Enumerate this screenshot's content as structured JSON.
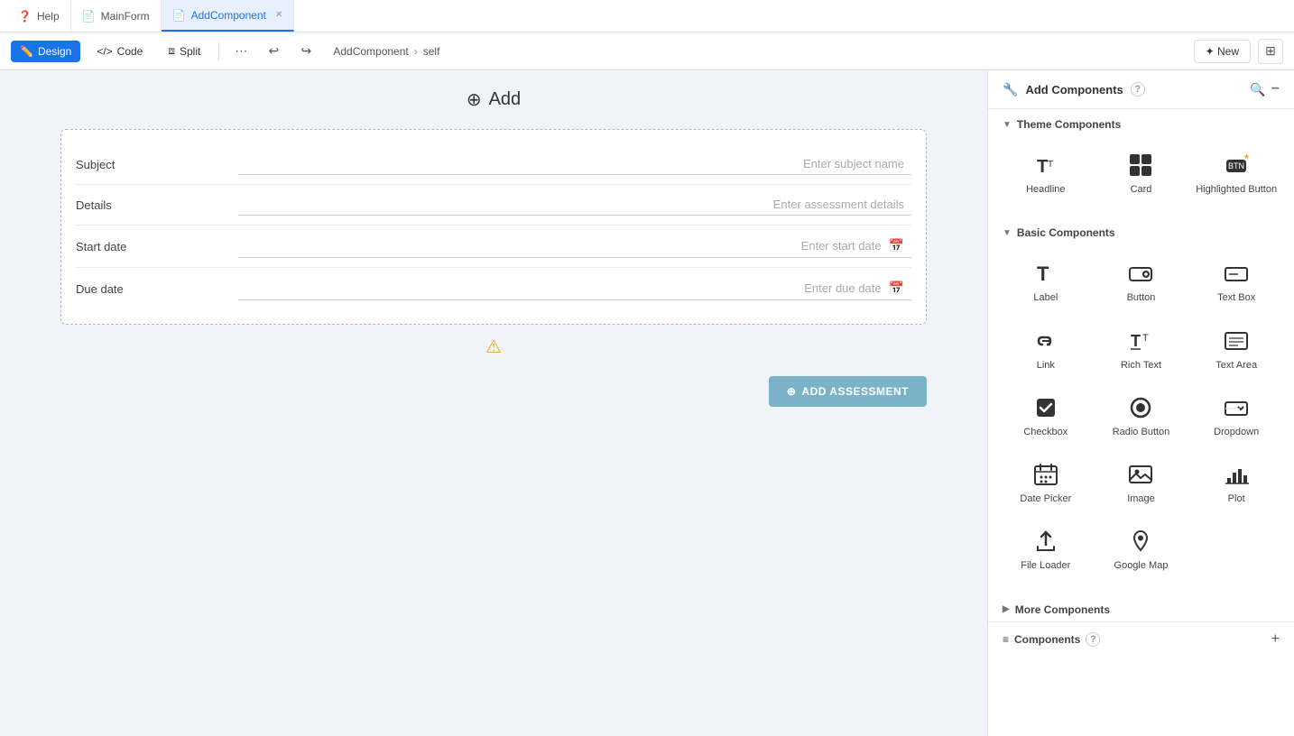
{
  "tabs": [
    {
      "id": "help",
      "label": "Help",
      "icon": "❓",
      "active": false,
      "closeable": false
    },
    {
      "id": "mainform",
      "label": "MainForm",
      "icon": "📄",
      "active": false,
      "closeable": false
    },
    {
      "id": "addcomponent",
      "label": "AddComponent",
      "icon": "📄",
      "active": true,
      "closeable": true
    }
  ],
  "toolbar": {
    "design_label": "Design",
    "code_label": "Code",
    "split_label": "Split",
    "undo_icon": "↩",
    "redo_icon": "↪",
    "more_icon": "⋯",
    "breadcrumb": [
      "AddComponent",
      "self"
    ],
    "new_label": "✦ New",
    "layout_icon": "⊞"
  },
  "canvas": {
    "title": "Add",
    "title_icon": "⊕",
    "form": {
      "fields": [
        {
          "label": "Subject",
          "placeholder": "Enter subject name",
          "type": "text"
        },
        {
          "label": "Details",
          "placeholder": "Enter assessment details",
          "type": "text"
        },
        {
          "label": "Start date",
          "placeholder": "Enter start date",
          "type": "date"
        },
        {
          "label": "Due date",
          "placeholder": "Enter due date",
          "type": "date"
        }
      ]
    },
    "add_button_label": "ADD ASSESSMENT"
  },
  "right_panel": {
    "title": "Add Components",
    "help_label": "?",
    "sections": [
      {
        "id": "theme",
        "label": "Theme Components",
        "expanded": true,
        "items": [
          {
            "id": "headline",
            "label": "Headline",
            "icon": "T"
          },
          {
            "id": "card",
            "label": "Card",
            "icon": "⊞"
          },
          {
            "id": "highlighted_button",
            "label": "Highlighted Button",
            "icon": "👆"
          }
        ]
      },
      {
        "id": "basic",
        "label": "Basic Components",
        "expanded": true,
        "items": [
          {
            "id": "label",
            "label": "Label",
            "icon": "T"
          },
          {
            "id": "button",
            "label": "Button",
            "icon": "🖱"
          },
          {
            "id": "text_box",
            "label": "Text Box",
            "icon": "▭"
          },
          {
            "id": "link",
            "label": "Link",
            "icon": "🔗"
          },
          {
            "id": "rich_text",
            "label": "Rich Text",
            "icon": "T"
          },
          {
            "id": "text_area",
            "label": "Text Area",
            "icon": "▭"
          },
          {
            "id": "checkbox",
            "label": "Checkbox",
            "icon": "☑"
          },
          {
            "id": "radio_button",
            "label": "Radio Button",
            "icon": "◎"
          },
          {
            "id": "dropdown",
            "label": "Dropdown",
            "icon": "☰"
          },
          {
            "id": "date_picker",
            "label": "Date Picker",
            "icon": "📅"
          },
          {
            "id": "image",
            "label": "Image",
            "icon": "🖼"
          },
          {
            "id": "plot",
            "label": "Plot",
            "icon": "📊"
          },
          {
            "id": "file_loader",
            "label": "File Loader",
            "icon": "⬆"
          },
          {
            "id": "google_map",
            "label": "Google Map",
            "icon": "📍"
          }
        ]
      },
      {
        "id": "more",
        "label": "More Components",
        "expanded": false,
        "items": []
      }
    ],
    "footer": {
      "label": "Components",
      "help_label": "?"
    }
  }
}
